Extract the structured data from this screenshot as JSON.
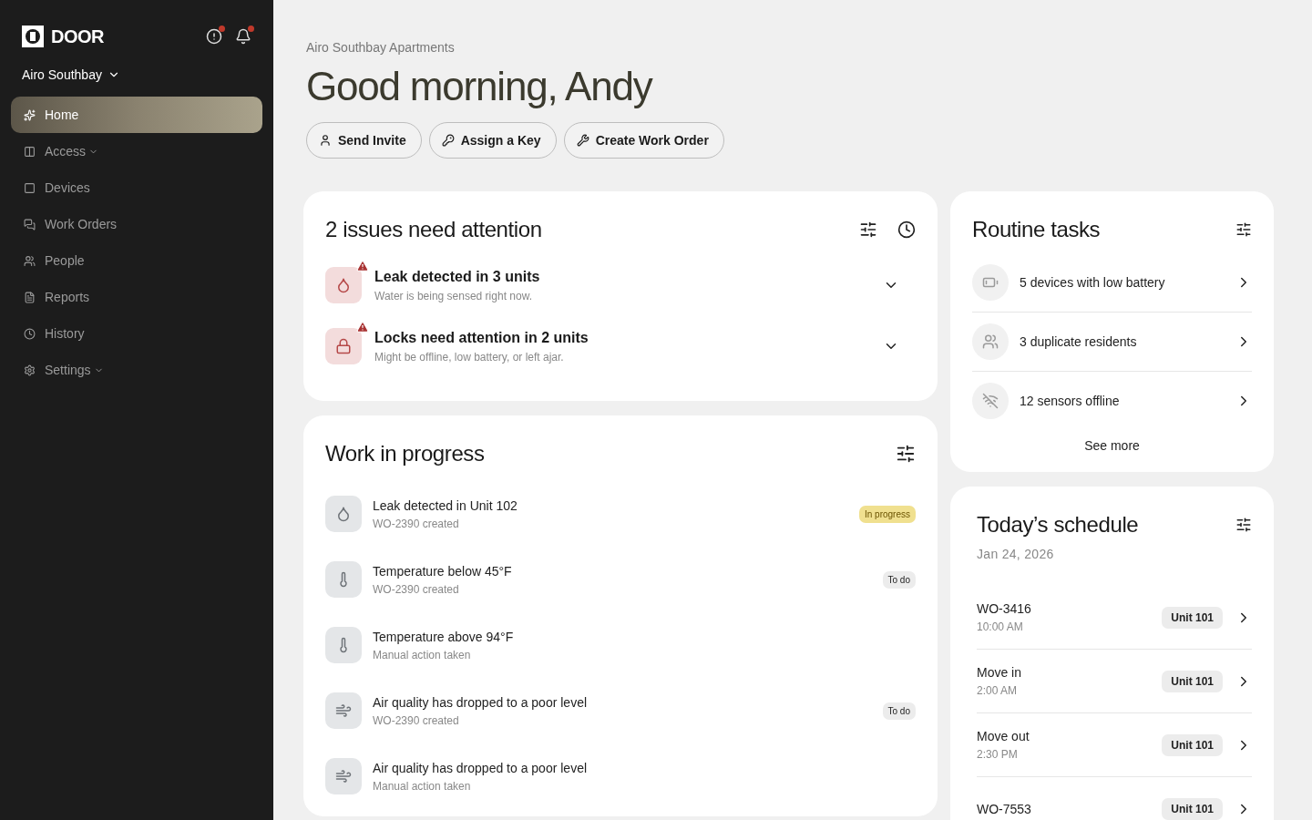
{
  "sidebar": {
    "logo": "DOOR",
    "notifications": {
      "alert_dot": true,
      "bell_dot": true
    },
    "property": "Airo Southbay",
    "items": [
      {
        "label": "Home",
        "selected": true,
        "kind": "link"
      },
      {
        "label": "Access",
        "selected": false,
        "kind": "group"
      },
      {
        "label": "Devices",
        "selected": false,
        "kind": "link"
      },
      {
        "label": "Work Orders",
        "selected": false,
        "kind": "link"
      },
      {
        "label": "People",
        "selected": false,
        "kind": "link"
      },
      {
        "label": "Reports",
        "selected": false,
        "kind": "link"
      },
      {
        "label": "History",
        "selected": false,
        "kind": "link"
      },
      {
        "label": "Settings",
        "selected": false,
        "kind": "group"
      }
    ]
  },
  "header": {
    "breadcrumb": "Airo Southbay Apartments",
    "greeting": "Good morning, Andy",
    "actions": [
      "Send Invite",
      "Assign a Key",
      "Create Work Order"
    ]
  },
  "issues": {
    "title": "2 issues need attention",
    "items": [
      {
        "kind": "leak",
        "title": "Leak detected in 3 units",
        "subtitle": "Water is being sensed right now.",
        "expanded": false
      },
      {
        "kind": "lock",
        "title": "Locks need attention in 2 units",
        "subtitle": "Might be offline, low battery, or left ajar.",
        "expanded": false
      }
    ]
  },
  "work_in_progress": {
    "title": "Work in progress",
    "items": [
      {
        "kind": "leak",
        "title": "Leak detected in Unit 102",
        "subtitle": "WO-2390 created",
        "status": {
          "label": "In progress",
          "kind": "active"
        }
      },
      {
        "kind": "temperature",
        "title": "Temperature below 45°F",
        "subtitle": "WO-2390 created",
        "status": {
          "label": "To do",
          "kind": "todo"
        }
      },
      {
        "kind": "temperature",
        "title": "Temperature above 94°F",
        "subtitle": "Manual action taken"
      },
      {
        "kind": "air",
        "title": "Air quality has dropped to a poor level",
        "subtitle": "WO-2390 created",
        "status": {
          "label": "To do",
          "kind": "todo"
        }
      },
      {
        "kind": "air",
        "title": "Air quality has dropped to a poor level",
        "subtitle": "Manual action taken"
      }
    ]
  },
  "routine_tasks": {
    "title": "Routine tasks",
    "items": [
      {
        "kind": "battery",
        "label": "5 devices with low battery"
      },
      {
        "kind": "people",
        "label": "3 duplicate residents"
      },
      {
        "kind": "offline",
        "label": "12 sensors offline"
      }
    ],
    "see_more": "See more"
  },
  "schedule": {
    "title": "Today’s schedule",
    "date": "Jan 24, 2026",
    "items": [
      {
        "title": "WO-3416",
        "time": "10:00 AM",
        "unit": "Unit 101"
      },
      {
        "title": "Move in",
        "time": "2:00 AM",
        "unit": "Unit 101"
      },
      {
        "title": "Move out",
        "time": "2:30 PM",
        "unit": "Unit 101"
      },
      {
        "title": "WO-7553",
        "unit": "Unit 101"
      }
    ]
  }
}
